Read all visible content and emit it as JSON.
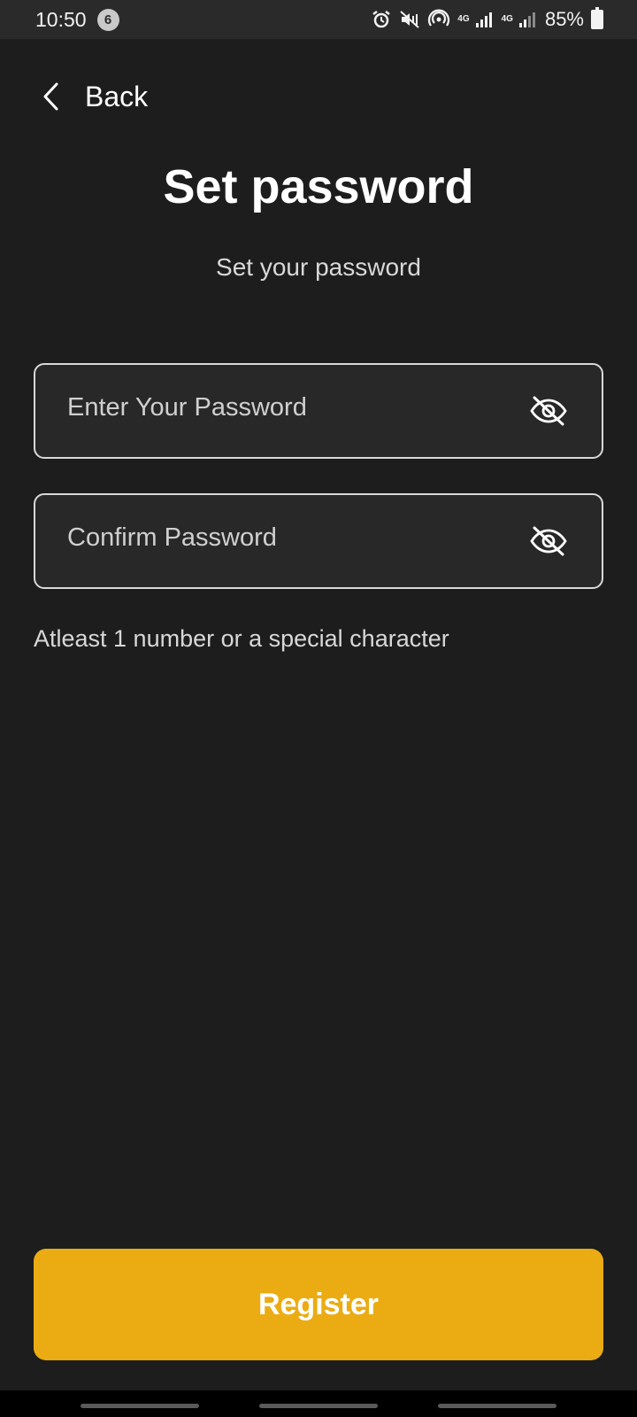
{
  "status_bar": {
    "time": "10:50",
    "notification_count": "6",
    "network_1": "4G",
    "network_2": "4G",
    "battery": "85%"
  },
  "header": {
    "back_label": "Back"
  },
  "page": {
    "title": "Set password",
    "subtitle": "Set your password"
  },
  "form": {
    "password_placeholder": "Enter Your Password",
    "confirm_placeholder": "Confirm Password",
    "hint": "Atleast 1 number or a special character"
  },
  "actions": {
    "register_label": "Register"
  },
  "colors": {
    "background": "#1d1d1d",
    "accent": "#ebac13",
    "field_border": "#d9d9d9"
  },
  "icons": {
    "back": "chevron-left-icon",
    "password_visibility": "eye-off-icon",
    "confirm_visibility": "eye-off-icon"
  }
}
